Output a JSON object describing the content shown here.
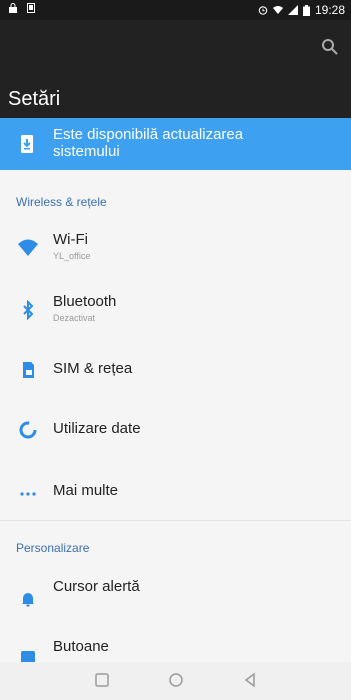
{
  "status": {
    "time": "19:28",
    "left_icons": [
      "lock-icon",
      "notification-icon"
    ],
    "right_icons": [
      "alarm-icon",
      "wifi-icon",
      "signal-icon",
      "battery-icon"
    ]
  },
  "header": {
    "title": "Setări",
    "search_icon": "search-icon"
  },
  "update_banner": {
    "text": "Este disponibilă actualizarea sistemului",
    "icon": "phone-update-icon"
  },
  "sections": {
    "wireless": {
      "label": "Wireless & rețele"
    },
    "personal": {
      "label": "Personalizare"
    }
  },
  "items": [
    {
      "title": "Wi-Fi",
      "subtitle": "YL_office",
      "icon": "wifi-icon"
    },
    {
      "title": "Bluetooth",
      "subtitle": "Dezactivat",
      "icon": "bluetooth-icon"
    },
    {
      "title": "SIM & rețea",
      "subtitle": "",
      "icon": "sim-card-icon"
    },
    {
      "title": "Utilizare date",
      "subtitle": "",
      "icon": "data-usage-icon"
    },
    {
      "title": "Mai multe",
      "subtitle": "",
      "icon": "more-dots-icon"
    },
    {
      "title": "Cursor alertă",
      "subtitle": "",
      "icon": "alert-bell-icon"
    },
    {
      "title": "Butoane",
      "subtitle": "",
      "icon": "buttons-icon"
    }
  ],
  "colors": {
    "accent": "#3ea0f0",
    "section_label": "#3a6fb0",
    "toolbar": "#222222"
  },
  "nav": [
    "recent-apps-icon",
    "home-icon",
    "back-icon"
  ]
}
